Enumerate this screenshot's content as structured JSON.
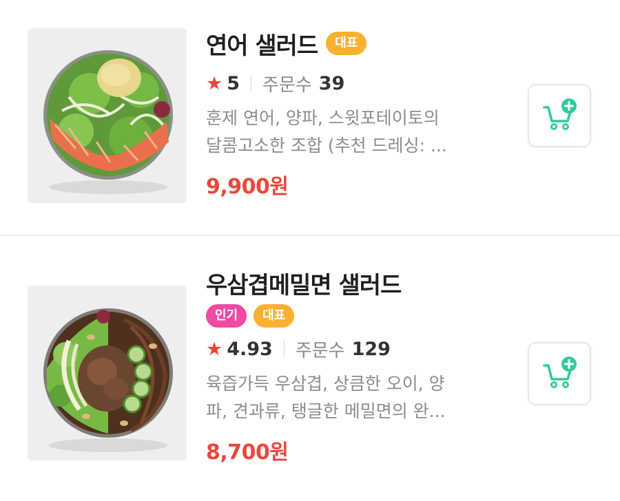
{
  "colors": {
    "accent": "#2dcc9a",
    "price": "#e9483c",
    "badge_rep": "#fbb030",
    "badge_pop": "#f14aa4",
    "star": "#ee4537"
  },
  "items": [
    {
      "title": "연어 샐러드",
      "badges": [
        "대표"
      ],
      "rating_icon": "★",
      "rating": "5",
      "orders_label": "주문수",
      "orders_count": "39",
      "desc_line1": "훈제 연어, 양파, 스윗포테이토의",
      "desc_line2": "달콤고소한 조합 (추천 드레싱: ...",
      "price": "9,900원",
      "image_icon": "salmon-salad-image",
      "cart_icon": "add-to-cart-icon"
    },
    {
      "title": "우삼겹메밀면 샐러드",
      "badges": [
        "인기",
        "대표"
      ],
      "rating_icon": "★",
      "rating": "4.93",
      "orders_label": "주문수",
      "orders_count": "129",
      "desc_line1": "육즙가득 우삼겹, 상큼한 오이, 양",
      "desc_line2": "파, 견과류, 탱글한 메밀면의 완...",
      "price": "8,700원",
      "image_icon": "beef-buckwheat-salad-image",
      "cart_icon": "add-to-cart-icon"
    }
  ]
}
